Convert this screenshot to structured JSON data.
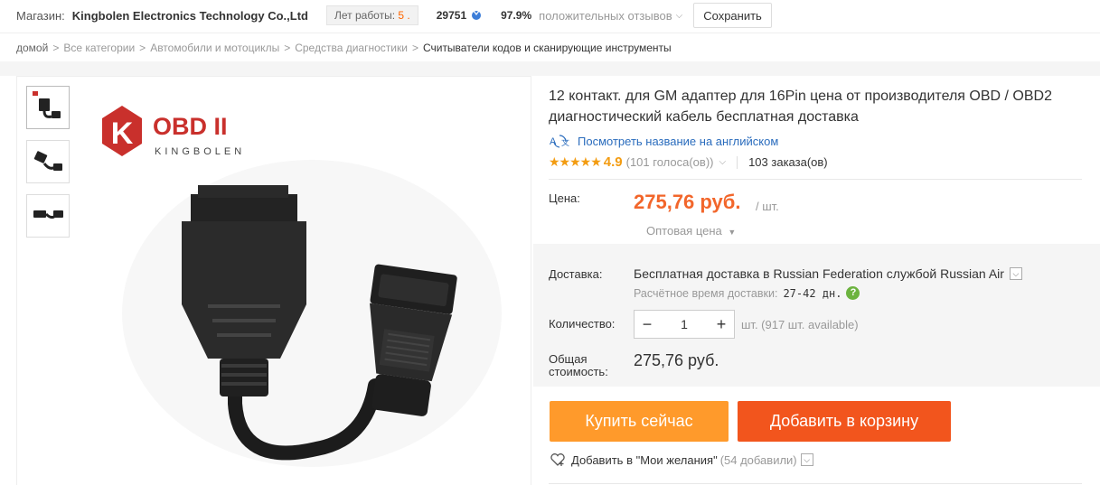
{
  "store": {
    "label": "Магазин:",
    "name": "Kingbolen Electronics Technology Co.,Ltd",
    "years_label": "Лет работы:",
    "years_value": "5 .",
    "score": "29751",
    "positive_pct": "97.9%",
    "positive_text": "положительных отзывов",
    "save_label": "Сохранить"
  },
  "breadcrumb": {
    "items": [
      "домой",
      "Все категории",
      "Автомобили и мотоциклы",
      "Средства диагностики",
      "Считыватели кодов и сканирующие инструменты"
    ],
    "separator": ">"
  },
  "gallery": {
    "logo_main": "OBD II",
    "logo_sub": "KINGBOLEN",
    "logo_letter": "K",
    "thumbnails": [
      "thumb-1",
      "thumb-2",
      "thumb-3"
    ]
  },
  "product": {
    "title": "12 контакт. для GM адаптер для 16Pin цена от производителя OBD / OBD2 диагностический кабель бесплатная доставка",
    "translate_link": "Посмотреть название на английском",
    "rating": "4.9",
    "votes": "(101 голоса(ов))",
    "orders": "103 заказа(ов)",
    "price_label": "Цена:",
    "price": "275,76 руб.",
    "per_unit": "/ шт.",
    "wholesale": "Оптовая цена"
  },
  "shipping": {
    "label": "Доставка:",
    "main_bold": "Бесплатная доставка",
    "main_rest": " в Russian Federation службой Russian Air",
    "time_label": "Расчётное время доставки:",
    "time_value": "27-42 дн."
  },
  "quantity": {
    "label": "Количество:",
    "value": "1",
    "minus": "−",
    "plus": "+",
    "available": "шт. (917 шт. available)"
  },
  "total": {
    "label_line1": "Общая",
    "label_line2": "стоимость:",
    "value": "275,76 руб."
  },
  "actions": {
    "buy_now": "Купить сейчас",
    "add_to_cart": "Добавить в корзину",
    "wishlist": "Добавить в \"Мои желания\"",
    "wishlist_count": "(54 добавили)"
  },
  "colors": {
    "price": "#f2662b",
    "buy_now": "#ff9a2b",
    "add_cart": "#f2551d",
    "link": "#2a6cbd",
    "star": "#f39c12"
  }
}
